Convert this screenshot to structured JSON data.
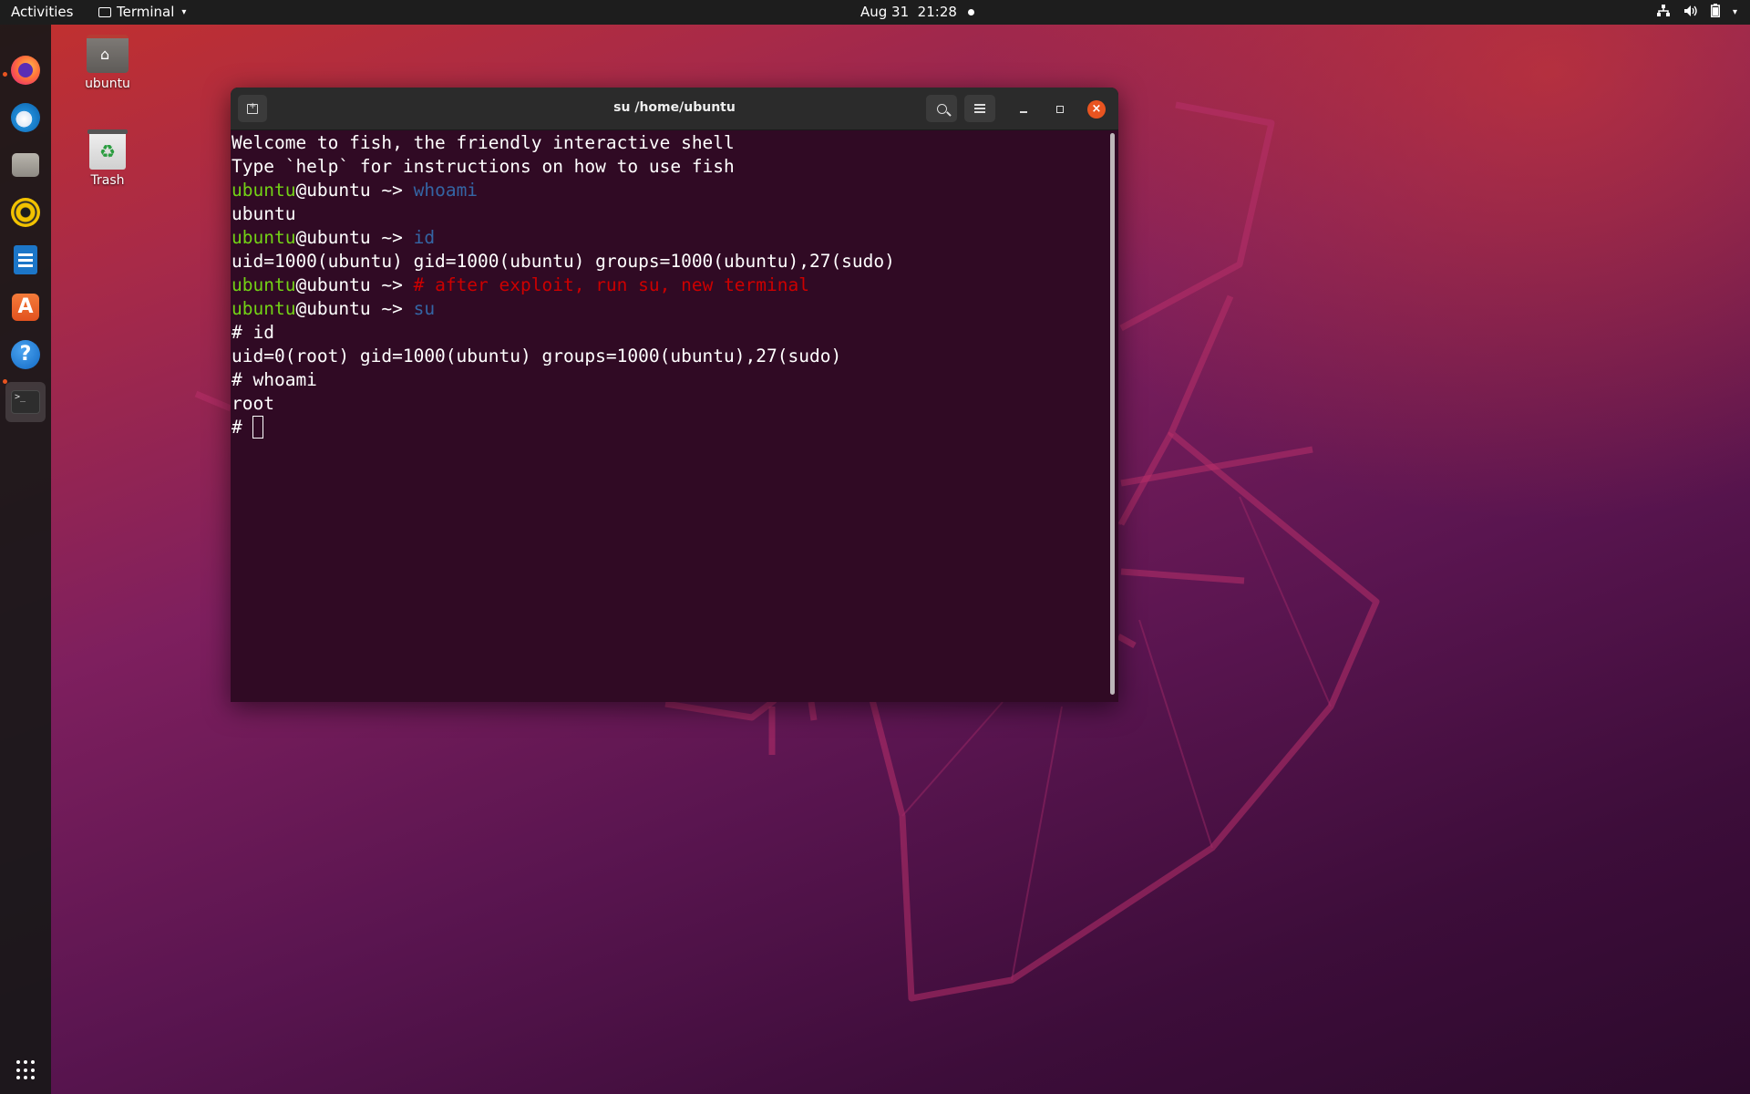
{
  "topbar": {
    "activities": "Activities",
    "app_name": "Terminal",
    "clock": "Aug 31  21:28",
    "icons": [
      "network-icon",
      "volume-icon",
      "battery-icon",
      "power-menu-chevron-icon"
    ]
  },
  "dock": {
    "items": [
      {
        "name": "firefox",
        "icon": "firefox-icon",
        "running": true
      },
      {
        "name": "thunderbird",
        "icon": "thunderbird-icon",
        "running": false
      },
      {
        "name": "files",
        "icon": "files-icon",
        "running": false
      },
      {
        "name": "rhythmbox",
        "icon": "rhythmbox-icon",
        "running": false
      },
      {
        "name": "libreoffice-writer",
        "icon": "writer-icon",
        "running": false
      },
      {
        "name": "ubuntu-software",
        "icon": "software-icon",
        "running": false
      },
      {
        "name": "help",
        "icon": "help-icon",
        "running": false
      },
      {
        "name": "terminal",
        "icon": "terminal-icon",
        "running": true,
        "active": true
      }
    ],
    "show_apps_icon": "grid-icon"
  },
  "desktop_icons": [
    {
      "label": "ubuntu",
      "icon": "home-folder-icon"
    },
    {
      "label": "Trash",
      "icon": "trash-icon"
    }
  ],
  "terminal": {
    "title": "su /home/ubuntu",
    "lines": {
      "l1": "Welcome to fish, the friendly interactive shell",
      "l2": "Type `help` for instructions on how to use fish",
      "prompt_user": "ubuntu",
      "prompt_host": "@ubuntu",
      "prompt_sep": " ~> ",
      "cmd1": "whoami",
      "out1": "ubuntu",
      "cmd2": "id",
      "out2": "uid=1000(ubuntu) gid=1000(ubuntu) groups=1000(ubuntu),27(sudo)",
      "cmd3": "# after exploit, run su, new terminal",
      "cmd4": "su",
      "root1": "# id",
      "out3": "uid=0(root) gid=1000(ubuntu) groups=1000(ubuntu),27(sudo)",
      "root2": "# whoami",
      "out4": "root",
      "root_prompt": "# "
    }
  },
  "colors": {
    "terminal_bg": "#300a24",
    "prompt_user": "#73d216",
    "command": "#3465a4",
    "comment": "#cc0000",
    "close_button": "#e95420"
  }
}
